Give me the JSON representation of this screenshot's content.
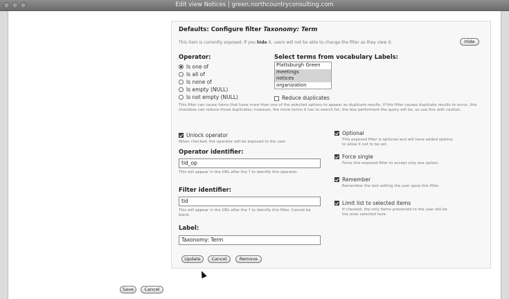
{
  "window": {
    "title": "Edit view Notices | green.northcountryconsulting.com"
  },
  "filter": {
    "heading": "Defaults: Configure filter ",
    "heading_filter_name": "Taxonomy: Term",
    "exposed_note_prefix": "This item is currently exposed. If you ",
    "exposed_note_hide_word": "hide",
    "exposed_note_suffix": " it, users will not be able to change the filter as they view it.",
    "hide_button": "Hide",
    "operator_label": "Operator:",
    "operators": [
      {
        "label": "Is one of",
        "selected": true
      },
      {
        "label": "Is all of",
        "selected": false
      },
      {
        "label": "Is none of",
        "selected": false
      },
      {
        "label": "Is empty (NULL)",
        "selected": false
      },
      {
        "label": "Is not empty (NULL)",
        "selected": false
      }
    ],
    "terms_label": "Select terms from vocabulary Labels:",
    "terms": [
      {
        "label": "Plattsburgh Green",
        "selected": false
      },
      {
        "label": "meetings",
        "selected": true
      },
      {
        "label": "notices",
        "selected": true
      },
      {
        "label": "organization",
        "selected": false
      }
    ],
    "reduce_duplicates_label": "Reduce duplicates",
    "reduce_duplicates_help": "This filter can cause items that have more than one of the selected options to appear as duplicate results. If this filter causes duplicate results to occur, this checkbox can reduce those duplicates; however, the more terms it has to search for, the less performant the query will be, so use this with caution.",
    "unlock_operator_label": "Unlock operator",
    "unlock_operator_help": "When checked, the operator will be exposed to the user",
    "operator_identifier_label": "Operator identifier:",
    "operator_identifier_value": "tid_op",
    "operator_identifier_help": "This will appear in the URL after the ? to identify this operator.",
    "filter_identifier_label": "Filter identifier:",
    "filter_identifier_value": "tid",
    "filter_identifier_help": "This will appear in the URL after the ? to identify this filter. Cannot be blank.",
    "label_label": "Label:",
    "label_value": "Taxonomy: Term",
    "optional_label": "Optional",
    "optional_help": "This exposed filter is optional and will have added options to allow it not to be set.",
    "force_single_label": "Force single",
    "force_single_help": "Force this exposed filter to accept only one option.",
    "remember_label": "Remember",
    "remember_help": "Remember the last setting the user gave this filter.",
    "limit_label": "Limit list to selected items",
    "limit_help": "If checked, the only items presented to the user will be the ones selected here.",
    "buttons": {
      "update": "Update",
      "cancel": "Cancel",
      "remove": "Remove"
    }
  },
  "footer": {
    "save": "Save",
    "cancel": "Cancel"
  }
}
